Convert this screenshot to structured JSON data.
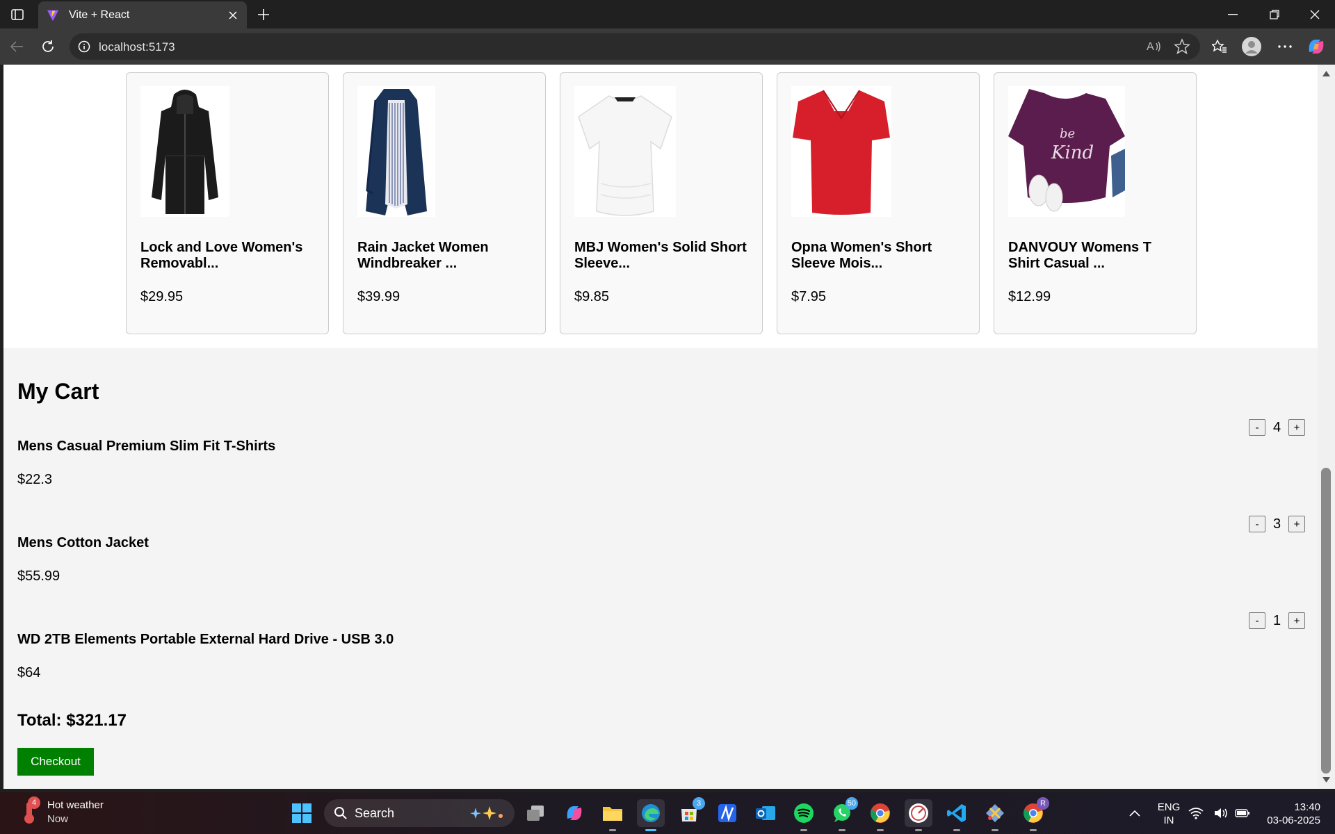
{
  "browser": {
    "tab_title": "Vite + React",
    "url": "localhost:5173"
  },
  "products": [
    {
      "title_line1": "Lock and Love Women's",
      "title_line2": "Removabl...",
      "price": "$29.95",
      "image": "black-leather-jacket"
    },
    {
      "title_line1": "Rain Jacket Women",
      "title_line2": "Windbreaker ...",
      "price": "$39.99",
      "image": "navy-rain-jacket"
    },
    {
      "title_line1": "MBJ Women's Solid Short",
      "title_line2": "Sleeve...",
      "price": "$9.85",
      "image": "white-tshirt"
    },
    {
      "title_line1": "Opna Women's Short",
      "title_line2": "Sleeve Mois...",
      "price": "$7.95",
      "image": "red-vneck-tshirt"
    },
    {
      "title_line1": "DANVOUY Womens T",
      "title_line2": "Shirt Casual ...",
      "price": "$12.99",
      "image": "purple-be-kind-tshirt",
      "image_text": "be Kind"
    }
  ],
  "cart": {
    "heading": "My Cart",
    "items": [
      {
        "name": "Mens Casual Premium Slim Fit T-Shirts",
        "price": "$22.3",
        "quantity": "4"
      },
      {
        "name": "Mens Cotton Jacket",
        "price": "$55.99",
        "quantity": "3"
      },
      {
        "name": "WD 2TB Elements Portable External Hard Drive - USB 3.0",
        "price": "$64",
        "quantity": "1"
      }
    ],
    "decrement_label": "-",
    "increment_label": "+",
    "total": "Total: $321.17",
    "checkout_label": "Checkout"
  },
  "taskbar": {
    "weather_title": "Hot weather",
    "weather_sub": "Now",
    "weather_badge": "4",
    "search_label": "Search",
    "store_badge": "3",
    "whatsapp_badge": "50",
    "chrome_profile_badge": "R",
    "lang_line1": "ENG",
    "lang_line2": "IN",
    "time": "13:40",
    "date": "03-06-2025"
  },
  "colors": {
    "checkout_green": "#008000",
    "page_bg": "#f4f4f4",
    "card_bg": "#f9f9f9"
  }
}
